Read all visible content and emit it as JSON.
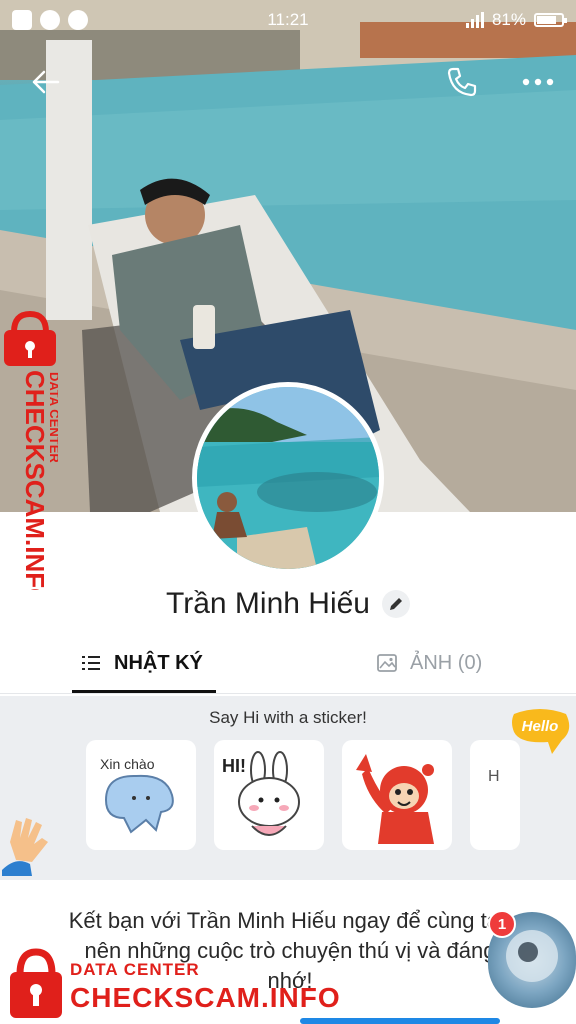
{
  "status_bar": {
    "time": "11:21",
    "battery_percent": "81%",
    "battery_level": 0.81
  },
  "header": {
    "back_icon": "arrow-left-icon",
    "call_icon": "phone-icon",
    "more_icon": "more-dots-icon"
  },
  "profile": {
    "name": "Trần Minh Hiếu",
    "edit_icon": "pencil-icon"
  },
  "tabs": [
    {
      "label": "NHẬT KÝ",
      "icon": "list-icon",
      "active": true
    },
    {
      "label": "ẢNH (0)",
      "icon": "image-icon",
      "active": false
    }
  ],
  "stickers": {
    "title": "Say Hi with a sticker!",
    "items": [
      {
        "label": "Xin chào"
      },
      {
        "label": "HI!"
      },
      {
        "label": ""
      }
    ],
    "partial_card_text": "H",
    "hello_badge": "Hello"
  },
  "invite": {
    "text": "Kết bạn với Trần Minh Hiếu ngay để cùng tạo nên những cuộc trò chuyện thú vị và đáng nhớ!"
  },
  "chat_head": {
    "badge_count": "1"
  },
  "watermark": {
    "side_small": "DATA CENTER",
    "side_big": "CHECKSCAM.INFO",
    "bottom_small": "DATA CENTER",
    "bottom_big": "CHECKSCAM.INFO"
  },
  "colors": {
    "accent_red": "#e0201b",
    "badge_red": "#ef3b3b",
    "active_tab": "#111111",
    "inactive_tab": "#9aa0a6"
  }
}
